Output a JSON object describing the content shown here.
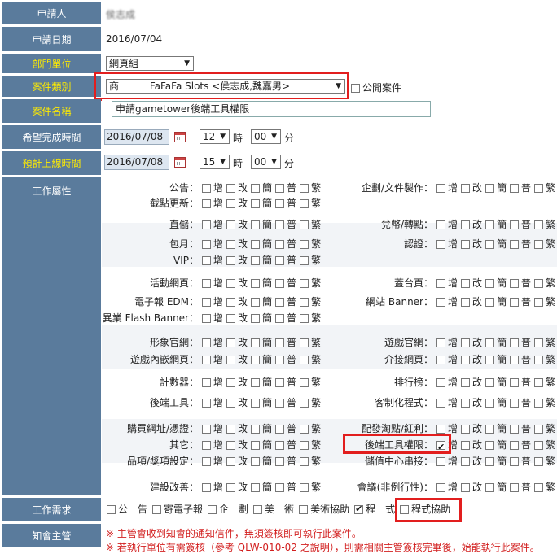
{
  "rows": {
    "applicant": {
      "label": "申請人",
      "value": "侯志成"
    },
    "apply_date": {
      "label": "申請日期",
      "value": "2016/07/04"
    },
    "department": {
      "label": "部門單位",
      "value": "網頁組"
    },
    "case_type": {
      "label": "案件類別",
      "prefix": "商",
      "value": "FaFaFa Slots <侯志成,魏嘉男>",
      "public_label": "公開案件"
    },
    "case_name": {
      "label": "案件名稱",
      "value": "申請gametower後端工具權限"
    },
    "hope_done": {
      "label": "希望完成時間",
      "date": "2016/07/08",
      "hour": "12",
      "hour_unit": "時",
      "minute": "00",
      "minute_unit": "分"
    },
    "plan_online": {
      "label": "預計上線時間",
      "date": "2016/07/08",
      "hour": "15",
      "hour_unit": "時",
      "minute": "00",
      "minute_unit": "分"
    },
    "attributes": {
      "label": "工作屬性"
    },
    "requirement": {
      "label": "工作需求"
    },
    "notify": {
      "label": "知會主管"
    }
  },
  "check_labels": [
    "增",
    "改",
    "簡",
    "普",
    "繁"
  ],
  "attributes_left": [
    {
      "name": "公告：",
      "checked": []
    },
    {
      "name": "截點更新：",
      "checked": []
    },
    {
      "name": "直儲：",
      "checked": []
    },
    {
      "name": "包月：",
      "checked": []
    },
    {
      "name": "VIP：",
      "checked": []
    },
    {
      "name": "活動網頁：",
      "checked": []
    },
    {
      "name": "電子報 EDM：",
      "checked": []
    },
    {
      "name": "異業 Flash Banner：",
      "checked": []
    },
    {
      "name": "形象官網：",
      "checked": []
    },
    {
      "name": "遊戲內嵌網頁：",
      "checked": []
    },
    {
      "name": "計數器：",
      "checked": []
    },
    {
      "name": "後端工具：",
      "checked": []
    },
    {
      "name": "購買網址/憑證：",
      "checked": []
    },
    {
      "name": "其它：",
      "checked": []
    },
    {
      "name": "品項/獎項設定：",
      "checked": []
    },
    {
      "name": "建設改善：",
      "checked": []
    }
  ],
  "attributes_right": [
    {
      "name": "企劃/文件製作：",
      "checked": []
    },
    {
      "name": "兌幣/轉點：",
      "checked": []
    },
    {
      "name": "認證：",
      "checked": []
    },
    {
      "name": "蓋台頁：",
      "checked": []
    },
    {
      "name": "網站 Banner：",
      "checked": []
    },
    {
      "name": "遊戲官網：",
      "checked": []
    },
    {
      "name": "介接網頁：",
      "checked": []
    },
    {
      "name": "排行榜：",
      "checked": []
    },
    {
      "name": "客制化程式：",
      "checked": []
    },
    {
      "name": "配發淘點/紅利：",
      "checked": []
    },
    {
      "name": "後端工具權限：",
      "checked": [
        "增"
      ]
    },
    {
      "name": "儲值中心串接：",
      "checked": []
    },
    {
      "name": "會議(非例行性)：",
      "checked": []
    }
  ],
  "requirements": [
    {
      "label": "公　告",
      "checked": false
    },
    {
      "label": "寄電子報",
      "checked": false
    },
    {
      "label": "企　劃",
      "checked": false
    },
    {
      "label": "美　術",
      "checked": false
    },
    {
      "label": "美術協助",
      "checked": false
    },
    {
      "label": "程　式",
      "checked": true
    },
    {
      "label": "程式協助",
      "checked": false
    }
  ],
  "notes": [
    "※ 主管會收到知會的通知信件，無須簽核即可執行此案件。",
    "※ 若執行單位有需簽核（參考 QLW-010-02 之說明），則需相關主管簽核完畢後，始能執行此案件。"
  ],
  "colors": {
    "label_bg": "#5a7b9c",
    "label_text": "#ffffff",
    "highlight_label": "#ffec00",
    "highlight_box": "#e21e1e",
    "note_text": "#d21f1f"
  }
}
